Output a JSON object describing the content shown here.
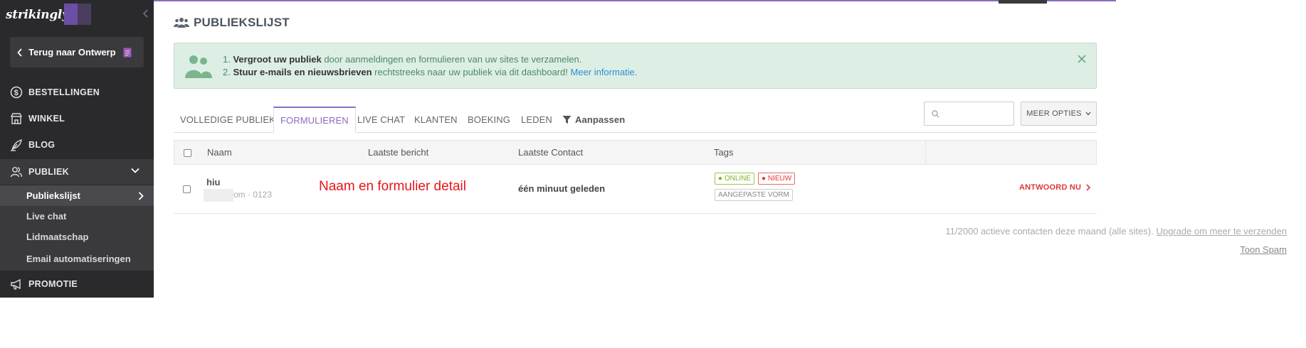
{
  "sidebar": {
    "brand": "strikingly",
    "back_label": "Terug naar Ontwerp",
    "nav": [
      {
        "label": "BESTELLINGEN",
        "icon": "dollar-circle-icon"
      },
      {
        "label": "WINKEL",
        "icon": "store-icon"
      },
      {
        "label": "BLOG",
        "icon": "feather-icon"
      },
      {
        "label": "PUBLIEK",
        "icon": "users-icon"
      },
      {
        "label": "PROMOTIE",
        "icon": "megaphone-icon"
      }
    ],
    "sub": [
      {
        "label": "Publiekslijst"
      },
      {
        "label": "Live chat"
      },
      {
        "label": "Lidmaatschap"
      },
      {
        "label": "Email automatiseringen"
      }
    ]
  },
  "page": {
    "title": "PUBLIEKSLIJST"
  },
  "notice": {
    "line1_prefix": "1. ",
    "line1_bold": "Vergroot uw publiek",
    "line1_rest": " door aanmeldingen en formulieren van uw sites te verzamelen.",
    "line2_prefix": "2. ",
    "line2_bold": "Stuur e-mails en nieuwsbrieven",
    "line2_rest": " rechtstreeks naar uw publiek via dit dashboard! ",
    "line2_link": "Meer informatie",
    "line2_end": "."
  },
  "tabs": [
    {
      "label": "VOLLEDIGE PUBLIEK"
    },
    {
      "label": "FORMULIEREN"
    },
    {
      "label": "LIVE CHAT"
    },
    {
      "label": "KLANTEN"
    },
    {
      "label": "BOEKING"
    },
    {
      "label": "LEDEN"
    },
    {
      "label": "Aanpassen"
    }
  ],
  "toolbar": {
    "more_label": "MEER OPTIES"
  },
  "table": {
    "headers": {
      "name": "Naam",
      "last_message": "Laatste bericht",
      "last_contact": "Laatste Contact",
      "tags": "Tags"
    },
    "rows": [
      {
        "name": "hiu",
        "sub": "om · 0123",
        "annotation": "Naam en formulier detail",
        "last_contact": "één minuut geleden",
        "tags": [
          "● ONLINE",
          "● NIEUW",
          "AANGEPASTE VORM"
        ],
        "action": "ANTWOORD NU"
      }
    ]
  },
  "footer": {
    "count_text": "11/2000 actieve contacten deze maand (alle sites). ",
    "upgrade_link": "Upgrade om meer te verzenden",
    "spam_link": "Toon Spam"
  },
  "colors": {
    "accent": "#8b6cc1",
    "sidebar_bg": "#2a2a2c",
    "notice_bg": "#ddeee5",
    "danger": "#e03838",
    "online": "#7bb02a"
  }
}
